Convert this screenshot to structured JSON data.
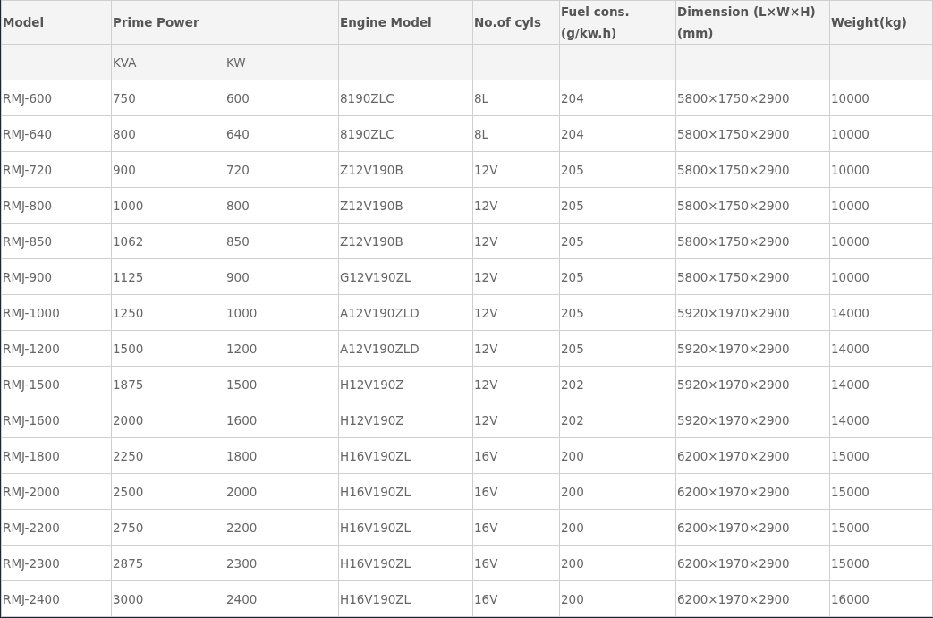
{
  "table": {
    "header_rows": [
      [
        "Model",
        "Prime Power",
        null,
        "Engine Model",
        "No.of cyls",
        "Fuel cons. (g/kw.h)",
        "Dimension (L×W×H) (mm)",
        "Weight(kg)"
      ],
      [
        null,
        "KVA",
        "KW",
        null,
        null,
        null,
        null,
        null
      ]
    ],
    "rows": [
      [
        "RMJ-600",
        "750",
        "600",
        "8190ZLC",
        "8L",
        "204",
        "5800×1750×2900",
        "10000"
      ],
      [
        "RMJ-640",
        "800",
        "640",
        "8190ZLC",
        "8L",
        "204",
        "5800×1750×2900",
        "10000"
      ],
      [
        "RMJ-720",
        "900",
        "720",
        "Z12V190B",
        "12V",
        "205",
        "5800×1750×2900",
        "10000"
      ],
      [
        "RMJ-800",
        "1000",
        "800",
        "Z12V190B",
        "12V",
        "205",
        "5800×1750×2900",
        "10000"
      ],
      [
        "RMJ-850",
        "1062",
        "850",
        "Z12V190B",
        "12V",
        "205",
        "5800×1750×2900",
        "10000"
      ],
      [
        "RMJ-900",
        "1125",
        "900",
        "G12V190ZL",
        "12V",
        "205",
        "5800×1750×2900",
        "10000"
      ],
      [
        "RMJ-1000",
        "1250",
        "1000",
        "A12V190ZLD",
        "12V",
        "205",
        "5920×1970×2900",
        "14000"
      ],
      [
        "RMJ-1200",
        "1500",
        "1200",
        "A12V190ZLD",
        "12V",
        "205",
        "5920×1970×2900",
        "14000"
      ],
      [
        "RMJ-1500",
        "1875",
        "1500",
        "H12V190Z",
        "12V",
        "202",
        "5920×1970×2900",
        "14000"
      ],
      [
        "RMJ-1600",
        "2000",
        "1600",
        "H12V190Z",
        "12V",
        "202",
        "5920×1970×2900",
        "14000"
      ],
      [
        "RMJ-1800",
        "2250",
        "1800",
        "H16V190ZL",
        "16V",
        "200",
        "6200×1970×2900",
        "15000"
      ],
      [
        "RMJ-2000",
        "2500",
        "2000",
        "H16V190ZL",
        "16V",
        "200",
        "6200×1970×2900",
        "15000"
      ],
      [
        "RMJ-2200",
        "2750",
        "2200",
        "H16V190ZL",
        "16V",
        "200",
        "6200×1970×2900",
        "15000"
      ],
      [
        "RMJ-2300",
        "2875",
        "2300",
        "H16V190ZL",
        "16V",
        "200",
        "6200×1970×2900",
        "15000"
      ],
      [
        "RMJ-2400",
        "3000",
        "2400",
        "H16V190ZL",
        "16V",
        "200",
        "6200×1970×2900",
        "16000"
      ]
    ]
  }
}
